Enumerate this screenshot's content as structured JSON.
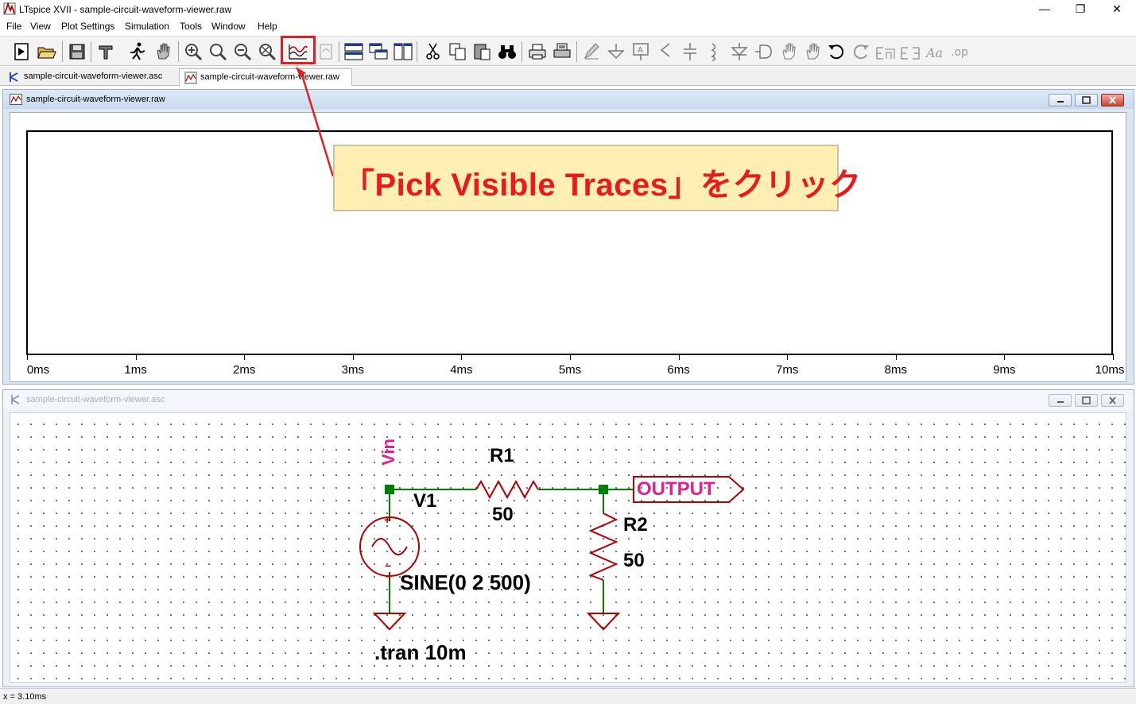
{
  "window": {
    "title": "LTspice XVII - sample-circuit-waveform-viewer.raw",
    "minimize": "—",
    "maximize": "❐",
    "close": "✕"
  },
  "menu": [
    "File",
    "View",
    "Plot Settings",
    "Simulation",
    "Tools",
    "Window",
    "Help"
  ],
  "tabs": [
    {
      "label": "sample-circuit-waveform-viewer.asc",
      "active": false
    },
    {
      "label": "sample-circuit-waveform-viewer.raw",
      "active": true
    }
  ],
  "plot_window": {
    "title": "sample-circuit-waveform-viewer.raw",
    "x_axis_labels": [
      "0ms",
      "1ms",
      "2ms",
      "3ms",
      "4ms",
      "5ms",
      "6ms",
      "7ms",
      "8ms",
      "9ms",
      "10ms"
    ]
  },
  "schematic_window": {
    "title": "sample-circuit-waveform-viewer.asc",
    "labels": {
      "vin": "Vin",
      "r1_name": "R1",
      "r1_value": "50",
      "v1_name": "V1",
      "v1_value": "SINE(0 2 500)",
      "output": "OUTPUT",
      "r2_name": "R2",
      "r2_value": "50",
      "directive": ".tran 10m",
      "plus": "+",
      "minus": "−"
    }
  },
  "annotation": {
    "text": "「Pick Visible Traces」をクリック",
    "color": "#ea1a1a",
    "background": "#ffefb2"
  },
  "status": {
    "text": "x = 3.10ms"
  },
  "colors": {
    "wire": "#008000",
    "component": "#b00000",
    "label": "#e0208c",
    "highlight": "#e02020"
  }
}
